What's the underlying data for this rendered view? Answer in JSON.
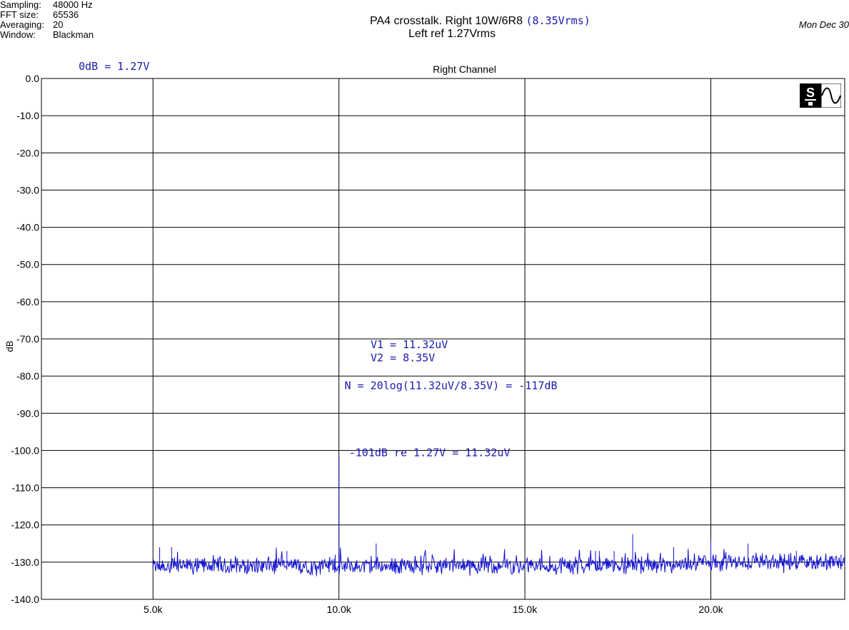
{
  "meta": [
    {
      "key": "Sampling:",
      "value": "48000 Hz"
    },
    {
      "key": "FFT size:",
      "value": "65536"
    },
    {
      "key": "Averaging:",
      "value": "20"
    },
    {
      "key": "Window:",
      "value": "Blackman"
    }
  ],
  "title_line1": "PA4 crosstalk. Right 10W/6R8",
  "title_line1_blue": "(8.35Vrms)",
  "title_line2": "Left ref 1.27Vrms",
  "date": "Mon Dec 30",
  "colors": {
    "trace": "#1010d0",
    "annotation": "#1a1ab0",
    "grid": "#000000"
  },
  "chart_data": {
    "type": "line",
    "title": "Right Channel",
    "ylabel": "dB",
    "xlabel": "",
    "xlim": [
      2000,
      23600
    ],
    "ylim": [
      -140,
      0
    ],
    "grid": true,
    "x_ticks": [
      5000,
      10000,
      15000,
      20000
    ],
    "x_tick_labels": [
      "5.0k",
      "10.0k",
      "15.0k",
      "20.0k"
    ],
    "y_ticks": [
      0,
      -10,
      -20,
      -30,
      -40,
      -50,
      -60,
      -70,
      -80,
      -90,
      -100,
      -110,
      -120,
      -130,
      -140
    ],
    "y_tick_labels": [
      "0.0",
      "-10.0",
      "-20.0",
      "-30.0",
      "-40.0",
      "-50.0",
      "-60.0",
      "-70.0",
      "-80.0",
      "-90.0",
      "-100.0",
      "-110.0",
      "-120.0",
      "-130.0",
      "-140.0"
    ],
    "annotations": [
      {
        "text": "0dB = 1.27V",
        "x": 3000,
        "y": 2.3
      },
      {
        "text": "V1 = 11.32uV",
        "x": 10850,
        "y": -72.5
      },
      {
        "text": "V2 = 8.35V",
        "x": 10850,
        "y": -76
      },
      {
        "text": "N = 20log(11.32uV/8.35V) = -117dB",
        "x": 10150,
        "y": -83.5
      },
      {
        "text": "-101dB re 1.27V = 11.32uV",
        "x": 10270,
        "y": -101.5
      }
    ],
    "series": [
      {
        "x_start": 5000,
        "x_end": 23600,
        "noise_floor": -131,
        "peaks": [
          {
            "x": 10000,
            "y": -101.5
          },
          {
            "x": 5180,
            "y": -126
          },
          {
            "x": 5500,
            "y": -126
          },
          {
            "x": 8600,
            "y": -127
          },
          {
            "x": 9900,
            "y": -128
          },
          {
            "x": 11000,
            "y": -125
          },
          {
            "x": 16900,
            "y": -127
          },
          {
            "x": 17000,
            "y": -127
          },
          {
            "x": 17400,
            "y": -127
          },
          {
            "x": 17900,
            "y": -122.5
          },
          {
            "x": 19000,
            "y": -126
          },
          {
            "x": 20000,
            "y": -124
          },
          {
            "x": 21000,
            "y": -125
          },
          {
            "x": 22300,
            "y": -127
          },
          {
            "x": 23500,
            "y": -128
          }
        ]
      }
    ]
  }
}
